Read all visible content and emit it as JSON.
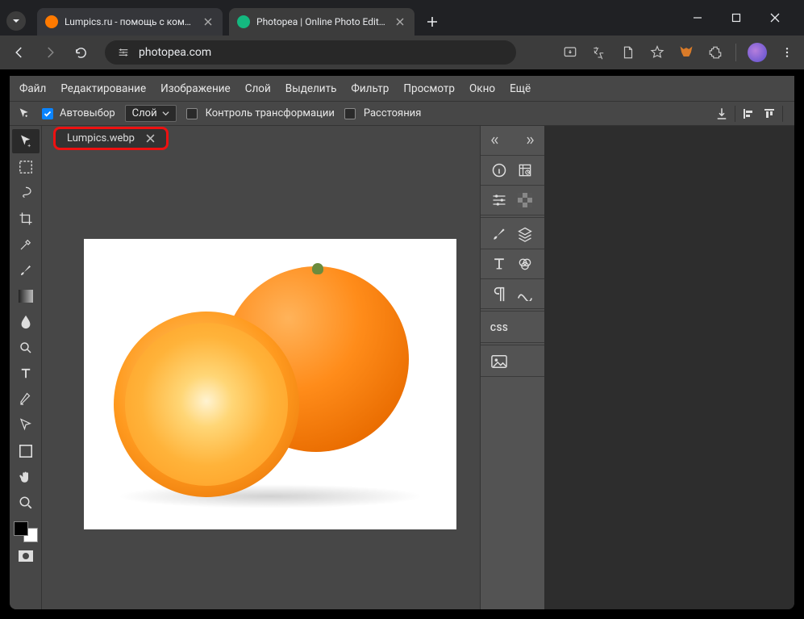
{
  "browser": {
    "tabs": [
      {
        "title": "Lumpics.ru - помощь с компью",
        "favicon_color": "#ff7a00"
      },
      {
        "title": "Photopea | Online Photo Editor",
        "favicon_color": "#14b87f"
      }
    ],
    "url": "photopea.com"
  },
  "menubar": {
    "file": "Файл",
    "edit": "Редактирование",
    "image": "Изображение",
    "layer": "Слой",
    "select": "Выделить",
    "filter": "Фильтр",
    "view": "Просмотр",
    "window": "Окно",
    "more": "Ещё"
  },
  "optbar": {
    "autoselect": "Автовыбор",
    "layer_dropdown": "Слой",
    "transform_controls": "Контроль трансформации",
    "distances": "Расстояния"
  },
  "document": {
    "tab_name": "Lumpics.webp"
  },
  "right_panel": {
    "css_label": "CSS"
  }
}
